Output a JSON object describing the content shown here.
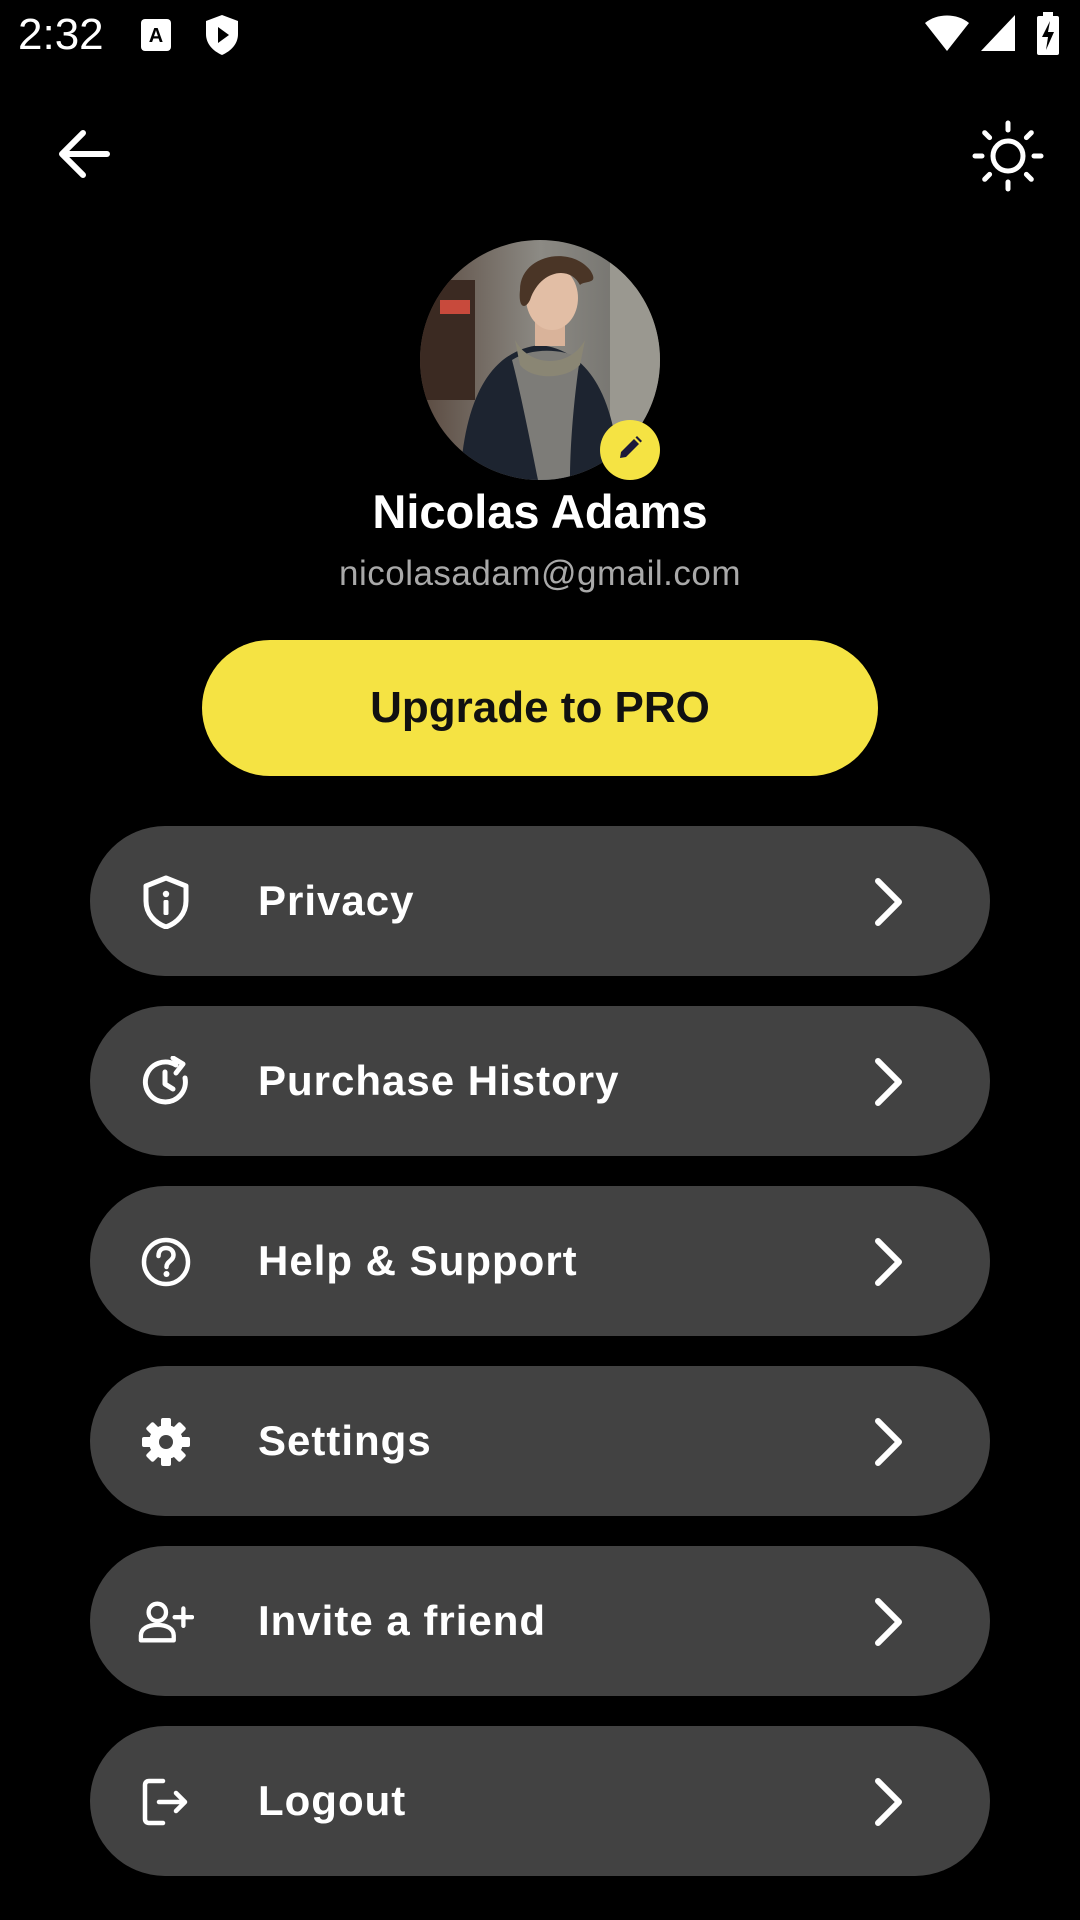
{
  "status_bar": {
    "time": "2:32",
    "icons": [
      "keyboard-a-icon",
      "shield-play-icon",
      "wifi-icon",
      "cellular-signal-icon",
      "battery-charging-icon"
    ]
  },
  "top_bar": {
    "back_icon": "arrow-left-icon",
    "theme_icon": "sun-icon"
  },
  "profile": {
    "name": "Nicolas Adams",
    "email": "nicolasadam@gmail.com",
    "edit_icon": "pencil-icon"
  },
  "upgrade": {
    "label": "Upgrade to PRO"
  },
  "menu": [
    {
      "label": "Privacy",
      "icon": "shield-info-icon"
    },
    {
      "label": "Purchase History",
      "icon": "history-icon"
    },
    {
      "label": "Help & Support",
      "icon": "help-circle-icon"
    },
    {
      "label": "Settings",
      "icon": "gear-icon"
    },
    {
      "label": "Invite a friend",
      "icon": "person-add-icon"
    },
    {
      "label": "Logout",
      "icon": "logout-icon"
    }
  ],
  "colors": {
    "background": "#000000",
    "accent": "#f5e343",
    "menu_item": "#424242",
    "email_text": "#a9a9a9"
  }
}
